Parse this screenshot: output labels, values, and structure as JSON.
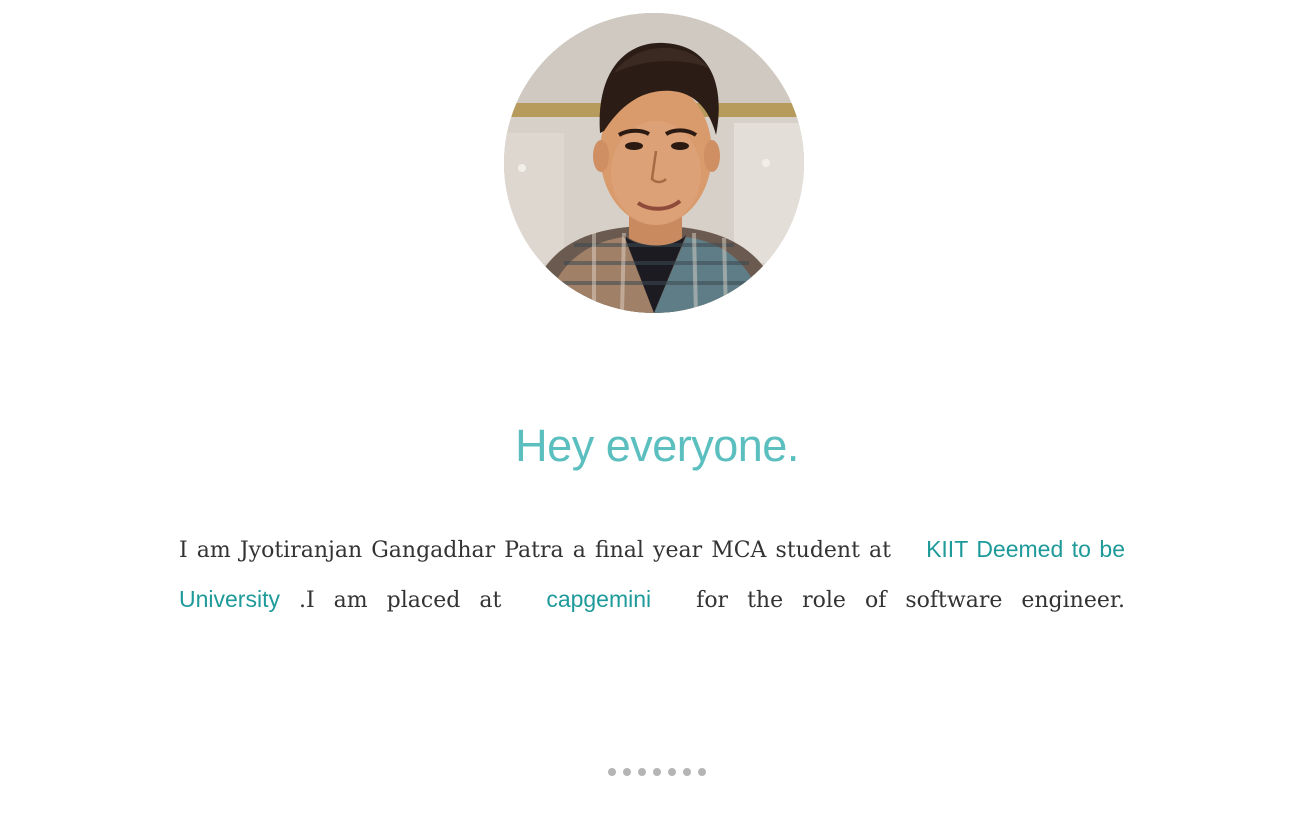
{
  "profile": {
    "avatar_alt": "profile photo"
  },
  "hero": {
    "headline": "Hey everyone."
  },
  "bio": {
    "part1": "I am Jyotiranjan Gangadhar Patra a final year MCA student at",
    "university_link": "KIIT Deemed to be University",
    "part2": ".I am placed at",
    "company_link": "capgemini",
    "part3": "for the role of software engineer."
  },
  "pagination": {
    "dot_count": 7
  },
  "colors": {
    "headline": "#5bbfbf",
    "link": "#1f9a9a",
    "body_text": "#333333",
    "dot": "#b5b5b5"
  }
}
